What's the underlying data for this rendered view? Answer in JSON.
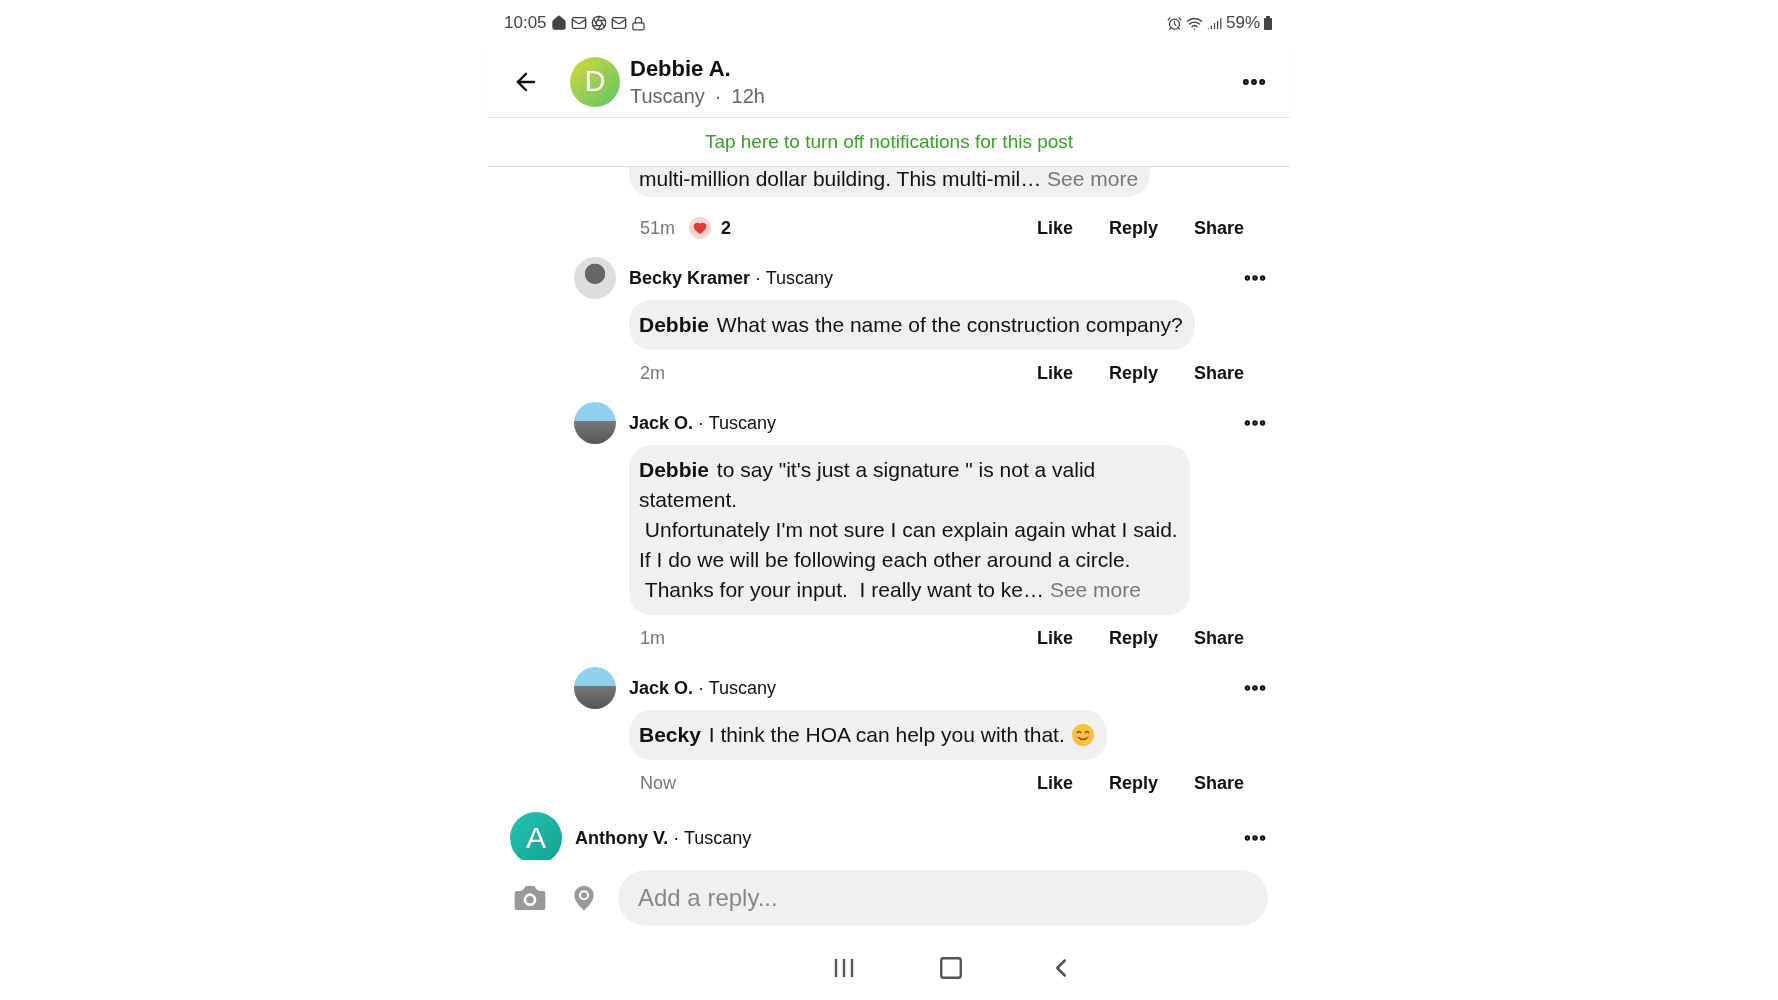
{
  "status_bar": {
    "time": "10:05",
    "battery": "59%"
  },
  "header": {
    "avatar_letter": "D",
    "name": "Debbie A.",
    "location": "Tuscany",
    "separator": "·",
    "age": "12h"
  },
  "banner": {
    "text": "Tap here to turn off notifications for this post"
  },
  "replies": [
    {
      "text": "multi-million dollar building. This multi-mil…",
      "see_more": "See more",
      "time": "51m",
      "reaction_count": "2",
      "actions": [
        "Like",
        "Reply",
        "Share"
      ]
    },
    {
      "author": "Becky Kramer",
      "location": "· Tuscany",
      "text": "**Debbie** What was the name of the construction company?",
      "time": "2m",
      "actions": [
        "Like",
        "Reply",
        "Share"
      ]
    },
    {
      "author": "Jack O.",
      "location": "· Tuscany",
      "text": "**Debbie** to say \"it's just a signature \" is not a valid\nstatement.\n Unfortunately I'm not sure I can explain again what I said.\nIf I do we will be following each other around a circle.\n Thanks for your input.  I really want to ke…",
      "see_more": "See more",
      "time": "1m",
      "actions": [
        "Like",
        "Reply",
        "Share"
      ]
    },
    {
      "author": "Jack O.",
      "location": "· Tuscany",
      "text": "**Becky** I think the HOA can help you with that.",
      "trailing_emoji": true,
      "time": "Now",
      "actions": [
        "Like",
        "Reply",
        "Share"
      ]
    }
  ],
  "next_comment": {
    "avatar_letter": "A",
    "author": "Anthony V.",
    "location": "· Tuscany"
  },
  "reply_bar": {
    "placeholder": "Add a reply..."
  }
}
